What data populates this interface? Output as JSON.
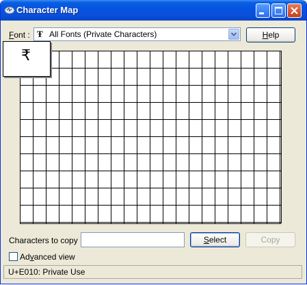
{
  "window": {
    "title": "Character Map"
  },
  "font_row": {
    "label_accel": "F",
    "label_rest": "ont :",
    "selected_font": "All Fonts (Private Characters)",
    "help_accel": "H",
    "help_rest": "elp"
  },
  "grid": {
    "enlarged_char": "₹"
  },
  "copy_row": {
    "label": "Characters to copy :",
    "value": "",
    "select_accel": "S",
    "select_rest": "elect",
    "copy_label": "Copy"
  },
  "advanced": {
    "label_pre": "Ad",
    "label_accel": "v",
    "label_post": "anced view",
    "checked": false
  },
  "status": {
    "text": "U+E010: Private Use"
  },
  "colors": {
    "titlebar": "#0554e3",
    "window_bg": "#ece9d8",
    "close_button": "#c4401c"
  },
  "icons": [
    "character-map-app-icon",
    "minimize-icon",
    "maximize-icon",
    "close-icon",
    "truetype-font-icon",
    "chevron-down-icon"
  ]
}
